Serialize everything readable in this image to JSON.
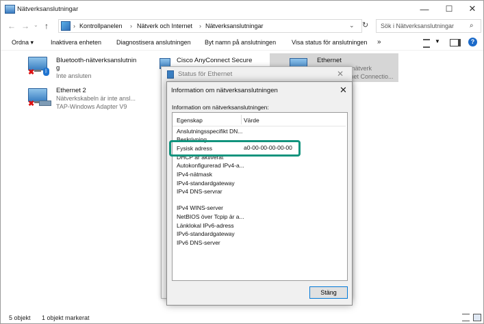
{
  "window": {
    "title": "Nätverksanslutningar",
    "controls": [
      "—",
      "☐",
      "✕"
    ]
  },
  "address": {
    "crumbs": [
      "Kontrollpanelen",
      "Nätverk och Internet",
      "Nätverksanslutningar"
    ],
    "search_placeholder": "Sök i Nätverksanslutningar"
  },
  "toolbar": {
    "organize": "Ordna ▾",
    "disable": "Inaktivera enheten",
    "diagnose": "Diagnostisera anslutningen",
    "rename": "Byt namn på anslutningen",
    "status": "Visa status för anslutningen",
    "more": "»"
  },
  "connections": [
    {
      "name": "Bluetooth-nätverksanslutnin",
      "name2": "g",
      "line": "Inte ansluten"
    },
    {
      "name": "Ethernet 2",
      "line": "Nätverkskabeln är inte ansl...",
      "line2": "TAP-Windows Adapter V9"
    },
    {
      "name": "Cisco AnyConnect Secure"
    },
    {
      "name": "Ethernet",
      "line": "...t nätverk",
      "line2": "...rnet Connectio..."
    }
  ],
  "status_dialog": {
    "title": "Status för Ethernet"
  },
  "info_dialog": {
    "title": "Information om nätverksanslutningen",
    "label": "Information om nätverksanslutningen:",
    "col_property": "Egenskap",
    "col_value": "Värde",
    "rows": [
      {
        "p": "Anslutningsspecifikt DN...",
        "v": ""
      },
      {
        "p": "Beskrivning",
        "v": ""
      },
      {
        "p": "Fysisk adress",
        "v": "a0-00-00-00-00-00"
      },
      {
        "p": "DHCP är aktiverat",
        "v": ""
      },
      {
        "p": "Autokonfigurerad IPv4-a...",
        "v": ""
      },
      {
        "p": "IPv4-nätmask",
        "v": ""
      },
      {
        "p": "IPv4-standardgateway",
        "v": ""
      },
      {
        "p": "IPv4 DNS-servrar",
        "v": ""
      },
      {
        "p": "IPv4 WINS-server",
        "v": ""
      },
      {
        "p": "NetBIOS över Tcpip är a...",
        "v": ""
      },
      {
        "p": "Länklokal IPv6-adress",
        "v": ""
      },
      {
        "p": "IPv6-standardgateway",
        "v": ""
      },
      {
        "p": "IPv6 DNS-server",
        "v": ""
      }
    ],
    "close_button": "Stäng"
  },
  "statusbar": {
    "count": "5 objekt",
    "selected": "1 objekt markerat"
  },
  "colors": {
    "highlight": "#11937d",
    "accent": "#0078d7"
  }
}
